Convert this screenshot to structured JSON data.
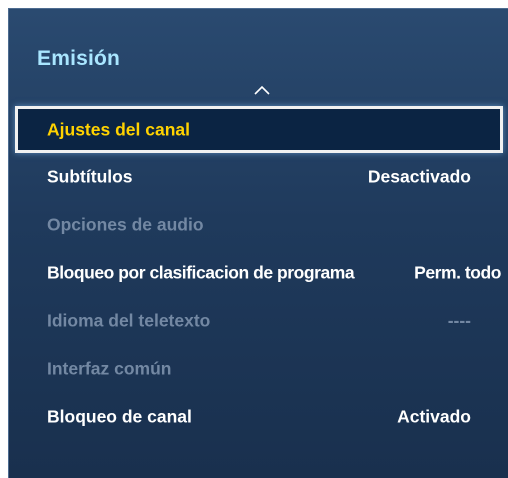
{
  "panel": {
    "title": "Emisión",
    "scroll_up_icon": "chevron-up-icon"
  },
  "menu": {
    "items": [
      {
        "label": "Ajustes del canal",
        "value": "",
        "state": "selected"
      },
      {
        "label": "Subtítulos",
        "value": "Desactivado",
        "state": "enabled"
      },
      {
        "label": "Opciones de audio",
        "value": "",
        "state": "disabled"
      },
      {
        "label": "Bloqueo por clasificacion de programa",
        "value": "Perm. todo",
        "state": "enabled"
      },
      {
        "label": "Idioma del teletexto",
        "value": "----",
        "state": "disabled"
      },
      {
        "label": "Interfaz común",
        "value": "",
        "state": "disabled"
      },
      {
        "label": "Bloqueo de canal",
        "value": "Activado",
        "state": "enabled"
      }
    ]
  },
  "colors": {
    "title": "#a9e6ff",
    "selected_text": "#ffd200",
    "enabled_text": "#ffffff",
    "disabled_text": "#7388a3",
    "panel_bg": "#1f3a5c",
    "selected_bg": "#0b2443"
  }
}
